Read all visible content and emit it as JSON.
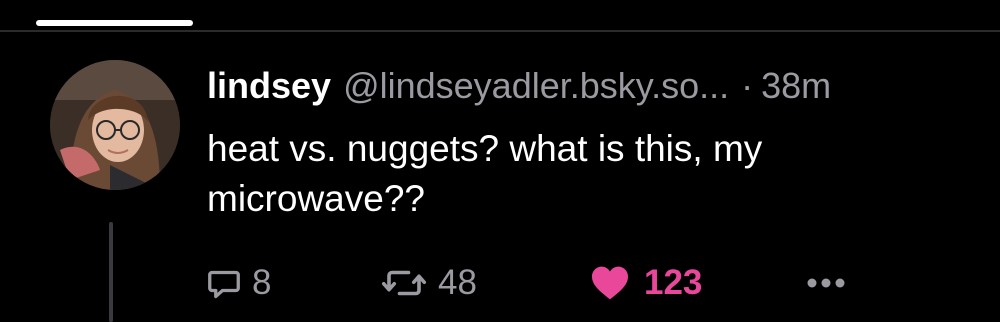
{
  "nav": {
    "active_tab_color": "#ffffff"
  },
  "post": {
    "author": {
      "display_name": "lindsey",
      "handle": "@lindseyadler.bsky.so...",
      "avatar": "profile-photo"
    },
    "separator": "·",
    "timestamp": "38m",
    "text": "heat vs. nuggets? what is this, my microwave??",
    "actions": {
      "reply": {
        "icon": "reply-icon",
        "count": "8"
      },
      "repost": {
        "icon": "repost-icon",
        "count": "48"
      },
      "like": {
        "icon": "heart-icon",
        "count": "123",
        "liked": true,
        "color": "#e8479a"
      },
      "more": {
        "icon": "more-icon"
      }
    }
  },
  "colors": {
    "background": "#000000",
    "text": "#ffffff",
    "muted": "#9a9aa1",
    "like": "#e8479a",
    "divider": "#2b2b2e"
  }
}
